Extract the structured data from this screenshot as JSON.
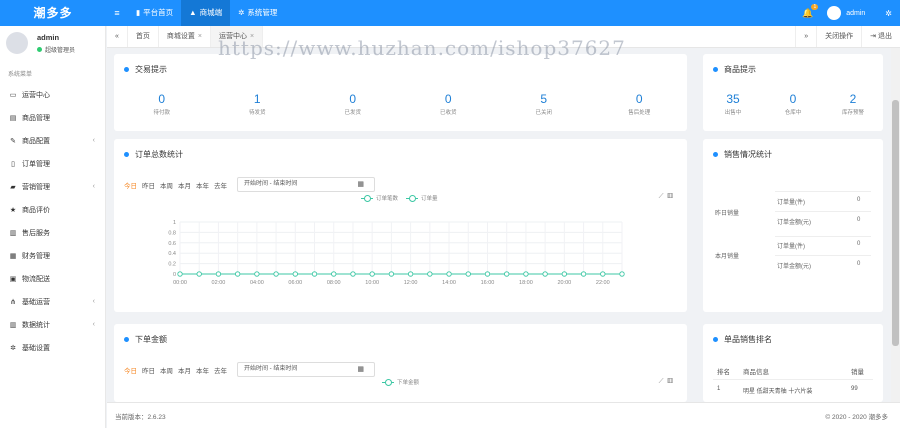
{
  "app": {
    "name": "潮多多"
  },
  "topnav": [
    {
      "label": "平台首页",
      "icon": "bookmark-icon"
    },
    {
      "label": "商城端",
      "icon": "shop-icon",
      "active": true
    },
    {
      "label": "系统管理",
      "icon": "gears-icon"
    }
  ],
  "topright": {
    "badge": "1",
    "user": "admin"
  },
  "profile": {
    "name": "admin",
    "role": "超级管理员"
  },
  "menu_heading": "系统菜单",
  "menu": [
    {
      "label": "运营中心",
      "icon": "monitor-icon",
      "glyph": "▭",
      "arrow": false
    },
    {
      "label": "商品管理",
      "icon": "box-icon",
      "glyph": "▤",
      "arrow": false
    },
    {
      "label": "商品配置",
      "icon": "pencil-icon",
      "glyph": "✎",
      "arrow": true
    },
    {
      "label": "订单管理",
      "icon": "document-icon",
      "glyph": "▯",
      "arrow": false
    },
    {
      "label": "营销管理",
      "icon": "truck-icon",
      "glyph": "▰",
      "arrow": true
    },
    {
      "label": "商品评价",
      "icon": "star-icon",
      "glyph": "★",
      "arrow": false
    },
    {
      "label": "售后服务",
      "icon": "service-icon",
      "glyph": "▥",
      "arrow": false
    },
    {
      "label": "财务管理",
      "icon": "wallet-icon",
      "glyph": "▦",
      "arrow": false
    },
    {
      "label": "物流配送",
      "icon": "shipping-icon",
      "glyph": "▣",
      "arrow": false
    },
    {
      "label": "基础运营",
      "icon": "share-icon",
      "glyph": "⋔",
      "arrow": true
    },
    {
      "label": "数据统计",
      "icon": "chart-icon",
      "glyph": "▥",
      "arrow": true
    },
    {
      "label": "基础设置",
      "icon": "gear-icon",
      "glyph": "✲",
      "arrow": false
    }
  ],
  "tabs": {
    "left_arrow": "«",
    "items": [
      {
        "label": "首页",
        "closable": false
      },
      {
        "label": "商城设置",
        "closable": true
      },
      {
        "label": "运营中心",
        "closable": true,
        "active": true
      }
    ],
    "right_arrow": "»",
    "close_ops": "关闭操作",
    "logout": "退出"
  },
  "watermark": "https://www.huzhan.com/ishop37627",
  "trade": {
    "title": "交易提示",
    "stats": [
      {
        "value": "0",
        "label": "待付款"
      },
      {
        "value": "1",
        "label": "待发货"
      },
      {
        "value": "0",
        "label": "已发货"
      },
      {
        "value": "0",
        "label": "已收货"
      },
      {
        "value": "5",
        "label": "已关闭"
      },
      {
        "value": "0",
        "label": "售后处理"
      }
    ]
  },
  "goods": {
    "title": "商品提示",
    "stats": [
      {
        "value": "35",
        "label": "出售中"
      },
      {
        "value": "0",
        "label": "仓库中"
      },
      {
        "value": "2",
        "label": "库存预警"
      }
    ]
  },
  "order_chart": {
    "title": "订单总数统计",
    "filters": [
      "今日",
      "昨日",
      "本周",
      "本月",
      "本年",
      "去年"
    ],
    "active_filter": "今日",
    "date_placeholder": "开始时间 - 结束时间",
    "legend": [
      "订单笔数",
      "订单量"
    ]
  },
  "chart_data": {
    "type": "line",
    "x": [
      "00:00",
      "01:00",
      "02:00",
      "03:00",
      "04:00",
      "05:00",
      "06:00",
      "07:00",
      "08:00",
      "09:00",
      "10:00",
      "11:00",
      "12:00",
      "13:00",
      "14:00",
      "15:00",
      "16:00",
      "17:00",
      "18:00",
      "19:00",
      "20:00",
      "21:00",
      "22:00",
      "23:00"
    ],
    "xtick_labels": [
      "00:00",
      "02:00",
      "04:00",
      "06:00",
      "08:00",
      "10:00",
      "12:00",
      "14:00",
      "16:00",
      "18:00",
      "20:00",
      "22:00"
    ],
    "series": [
      {
        "name": "订单笔数",
        "values": [
          0,
          0,
          0,
          0,
          0,
          0,
          0,
          0,
          0,
          0,
          0,
          0,
          0,
          0,
          0,
          0,
          0,
          0,
          0,
          0,
          0,
          0,
          0,
          0
        ]
      },
      {
        "name": "订单量",
        "values": [
          0,
          0,
          0,
          0,
          0,
          0,
          0,
          0,
          0,
          0,
          0,
          0,
          0,
          0,
          0,
          0,
          0,
          0,
          0,
          0,
          0,
          0,
          0,
          0
        ]
      }
    ],
    "ylim": [
      0,
      1
    ],
    "yticks": [
      "0",
      "0.2",
      "0.4",
      "0.6",
      "0.8",
      "1"
    ],
    "grid": true,
    "color": "#3cc7a4"
  },
  "sales": {
    "title": "销售情况统计",
    "groups": [
      {
        "label": "昨日销量",
        "rows": [
          {
            "name": "订单量(件)",
            "value": "0"
          },
          {
            "name": "订单金额(元)",
            "value": "0"
          }
        ]
      },
      {
        "label": "本月销量",
        "rows": [
          {
            "name": "订单量(件)",
            "value": "0"
          },
          {
            "name": "订单金额(元)",
            "value": "0"
          }
        ]
      }
    ]
  },
  "amount_chart": {
    "title": "下单金额",
    "filters": [
      "今日",
      "昨日",
      "本周",
      "本月",
      "本年",
      "去年"
    ],
    "active_filter": "今日",
    "date_placeholder": "开始时间 - 结束时间",
    "legend": [
      "下单金额"
    ]
  },
  "ranking": {
    "title": "单品销售排名",
    "headers": [
      "排名",
      "商品信息",
      "销量"
    ],
    "rows": [
      {
        "rank": "1",
        "name": "明星 低甜天青柚 十六片装",
        "sales": "99"
      }
    ]
  },
  "footer": {
    "version": "当前版本：2.6.23",
    "copyright": "© 2020 - 2020 潮多多"
  }
}
